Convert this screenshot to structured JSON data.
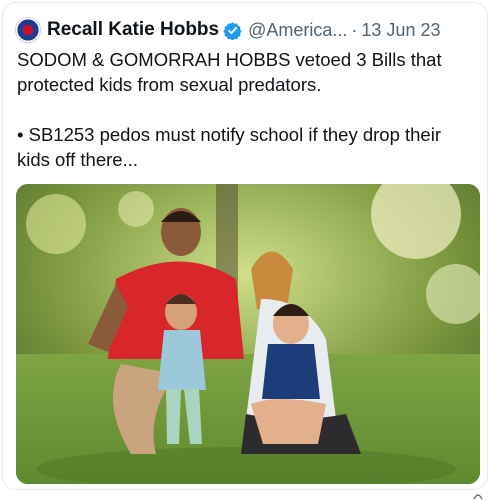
{
  "tweet": {
    "author_name": "Recall Katie Hobbs",
    "handle": "@America...",
    "separator": "·",
    "date": "13 Jun 23",
    "text_line1": "SODOM & GOMORRAH HOBBS vetoed 3 Bills that protected kids from sexual predators.",
    "text_line2": "• SB1253 pedos must notify school if they drop their kids off there..."
  },
  "icons": {
    "avatar": "avatar-logo",
    "verified": "verified-badge-icon"
  },
  "colors": {
    "text": "#0f1419",
    "secondary_text": "#536471",
    "verified_blue": "#1d9bf0",
    "border": "#e6e9ec"
  }
}
